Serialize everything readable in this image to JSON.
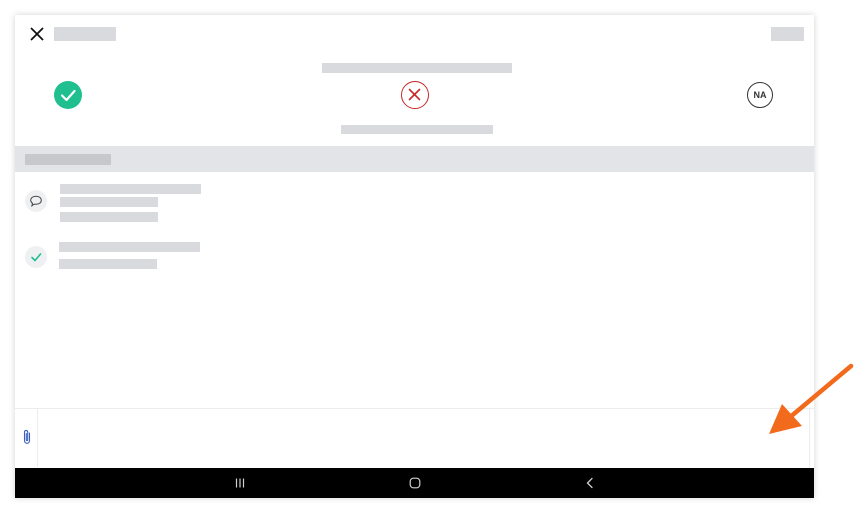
{
  "colors": {
    "pass": "#1fbf8f",
    "fail": "#c62828",
    "placeholder": "#d9dadd",
    "section_bar": "#e2e4e7",
    "annotation_arrow": "#f26a1b",
    "nav_bar": "#000000"
  },
  "header": {
    "close_icon": "close-icon",
    "action_icon": "placeholder"
  },
  "response_options": [
    {
      "name": "pass",
      "icon": "check-icon"
    },
    {
      "name": "fail",
      "icon": "x-icon"
    },
    {
      "name": "na",
      "label": "NA"
    }
  ],
  "activity": [
    {
      "type": "comment",
      "icon": "comment-icon"
    },
    {
      "type": "response",
      "icon": "check-icon"
    }
  ],
  "composer": {
    "attach_icon": "paperclip-icon",
    "value": "",
    "placeholder": ""
  },
  "nav_bar": {
    "buttons": [
      "recent-apps-icon",
      "home-icon",
      "back-icon"
    ]
  }
}
